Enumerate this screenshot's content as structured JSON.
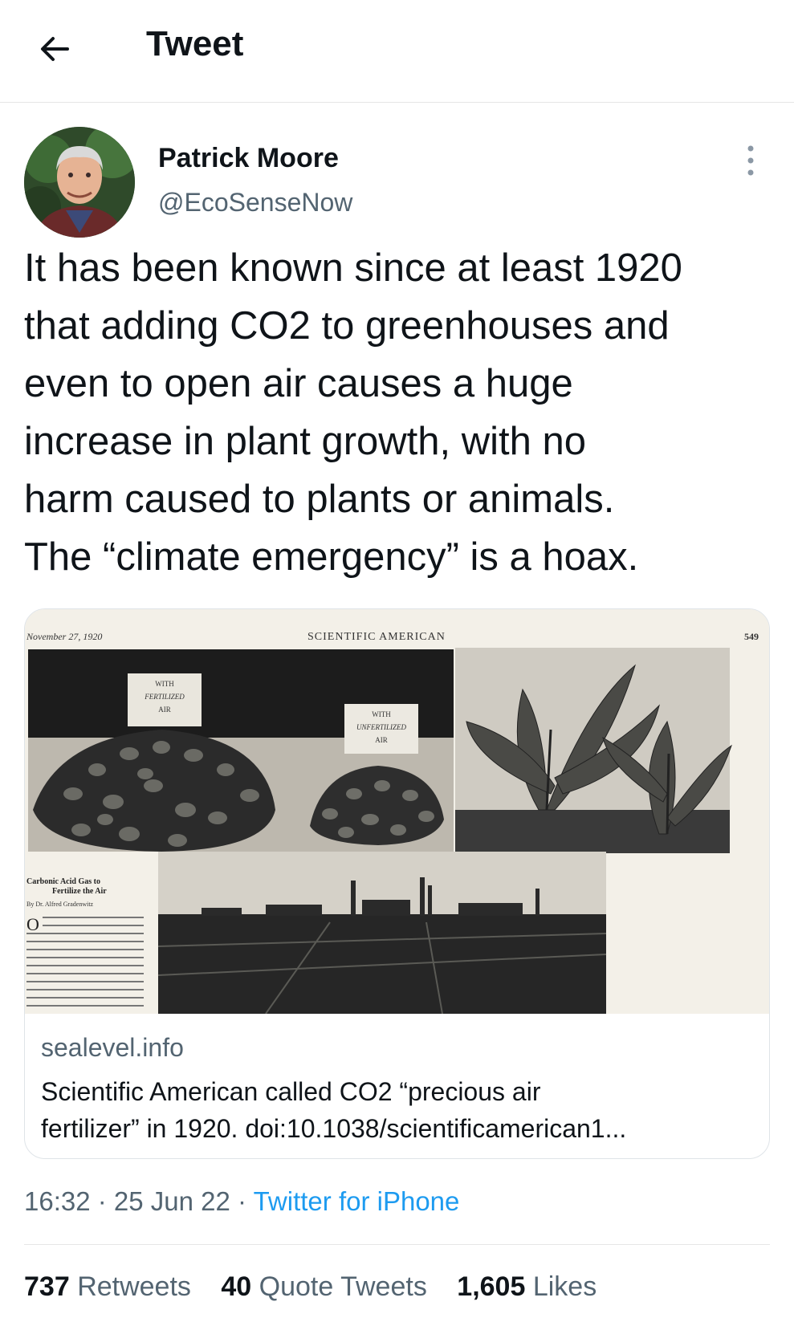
{
  "header": {
    "title": "Tweet",
    "back_icon": "arrow-left-icon"
  },
  "author": {
    "name": "Patrick Moore",
    "handle": "@EcoSenseNow"
  },
  "tweet": {
    "lines": [
      "It has been known since at least 1920",
      "that adding CO2 to greenhouses and",
      "even to open air causes a huge",
      "increase in plant growth, with no",
      "harm caused to plants or animals.",
      "The “climate emergency” is a hoax."
    ],
    "timestamp": "16:32 · 25 Jun 22 · ",
    "source": "Twitter for iPhone"
  },
  "card": {
    "image": {
      "date": "November 27, 1920",
      "masthead": "SCIENTIFIC AMERICAN",
      "page": "549",
      "sign_left": [
        "WITH",
        "FERTILIZED",
        "AIR"
      ],
      "sign_mid": [
        "WITH",
        "UNFERTILIZED",
        "AIR"
      ],
      "article_title": [
        "Carbonic Acid Gas to",
        "Fertilize the Air"
      ],
      "article_byline": "By Dr. Alfred Gradenwitz"
    },
    "domain": "sealevel.info",
    "description_lines": [
      "Scientific American called CO2 “precious air",
      "fertilizer” in 1920. doi:10.1038/scientificamerican1..."
    ]
  },
  "stats": {
    "retweets": {
      "count": "737",
      "label": "Retweets"
    },
    "quotes": {
      "count": "40",
      "label": "Quote Tweets"
    },
    "likes": {
      "count": "1,605",
      "label": "Likes"
    }
  }
}
